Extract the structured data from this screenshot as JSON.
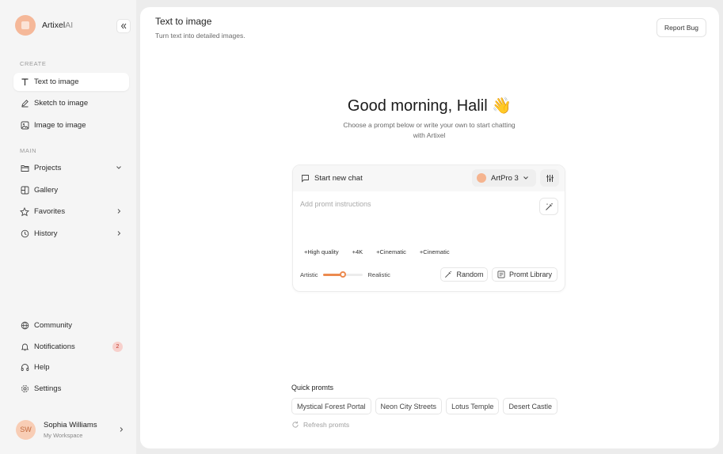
{
  "brand": {
    "name": "Artixel",
    "suffix": "AI"
  },
  "sidebar": {
    "create_label": "CREATE",
    "create_items": [
      {
        "label": "Text to image",
        "icon": "text-icon",
        "active": true
      },
      {
        "label": "Sketch to image",
        "icon": "pen-icon"
      },
      {
        "label": "Image to image",
        "icon": "image-icon"
      }
    ],
    "main_label": "MAIN",
    "main_items": [
      {
        "label": "Projects",
        "icon": "folder-icon"
      },
      {
        "label": "Gallery",
        "icon": "gallery-icon"
      },
      {
        "label": "Favorites",
        "icon": "star-icon"
      },
      {
        "label": "History",
        "icon": "history-icon"
      }
    ],
    "bottom_items": [
      {
        "label": "Community",
        "icon": "globe-icon"
      },
      {
        "label": "Notifications",
        "icon": "bell-icon",
        "badge": "2"
      },
      {
        "label": "Help",
        "icon": "headphones-icon"
      },
      {
        "label": "Settings",
        "icon": "gear-icon"
      }
    ],
    "user": {
      "initials": "SW",
      "name": "Sophia Williams",
      "workspace": "My Workspace"
    }
  },
  "header": {
    "title": "Text to image",
    "subtitle": "Turn text into detailed images.",
    "report_bug": "Report Bug"
  },
  "greeting": {
    "title": "Good morning, Halil",
    "emoji": "👋",
    "subtitle": "Choose a prompt below or write your own to start chatting with Artixel"
  },
  "composer": {
    "new_chat": "Start new chat",
    "model": "ArtPro 3",
    "prompt_value": "",
    "prompt_placeholder": "Add promt instructions",
    "tags": [
      "+High quality",
      "+4K",
      "+Cinematic",
      "+Cinematic"
    ],
    "style": {
      "left": "Artistic",
      "right": "Realistic",
      "level": 0.5
    },
    "random": "Random",
    "library": "Promt Library"
  },
  "quick": {
    "title": "Quick promts",
    "chips": [
      "Mystical Forest Portal",
      "Neon City Streets",
      "Lotus Temple",
      "Desert Castle"
    ],
    "refresh": "Refresh promts"
  },
  "colors": {
    "accent": "#ec8a4f",
    "avatar_bg": "#f8cdb5",
    "badge_bg": "#f7d0cc"
  }
}
